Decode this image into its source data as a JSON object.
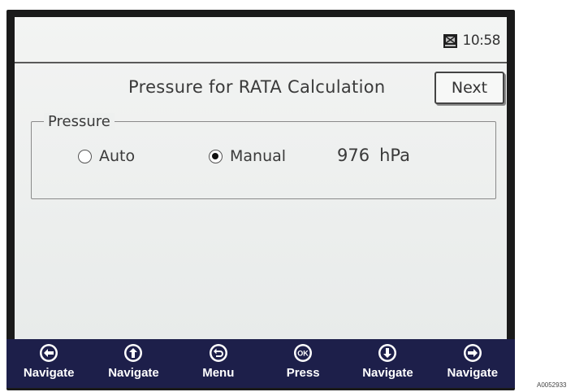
{
  "status": {
    "time": "10:58",
    "icon": "device-status-icon"
  },
  "page": {
    "title": "Pressure for RATA Calculation",
    "next_label": "Next"
  },
  "pressure_group": {
    "legend": "Pressure",
    "options": [
      {
        "label": "Auto",
        "selected": false
      },
      {
        "label": "Manual",
        "selected": true
      }
    ],
    "value": "976",
    "unit": "hPa"
  },
  "softkeys": [
    {
      "label": "Navigate",
      "icon": "arrow-left-circle-icon"
    },
    {
      "label": "Navigate",
      "icon": "arrow-up-circle-icon"
    },
    {
      "label": "Menu",
      "icon": "back-circle-icon"
    },
    {
      "label": "Press",
      "icon": "ok-circle-icon"
    },
    {
      "label": "Navigate",
      "icon": "arrow-down-circle-icon"
    },
    {
      "label": "Navigate",
      "icon": "arrow-right-circle-icon"
    }
  ],
  "caption": "A0052933"
}
